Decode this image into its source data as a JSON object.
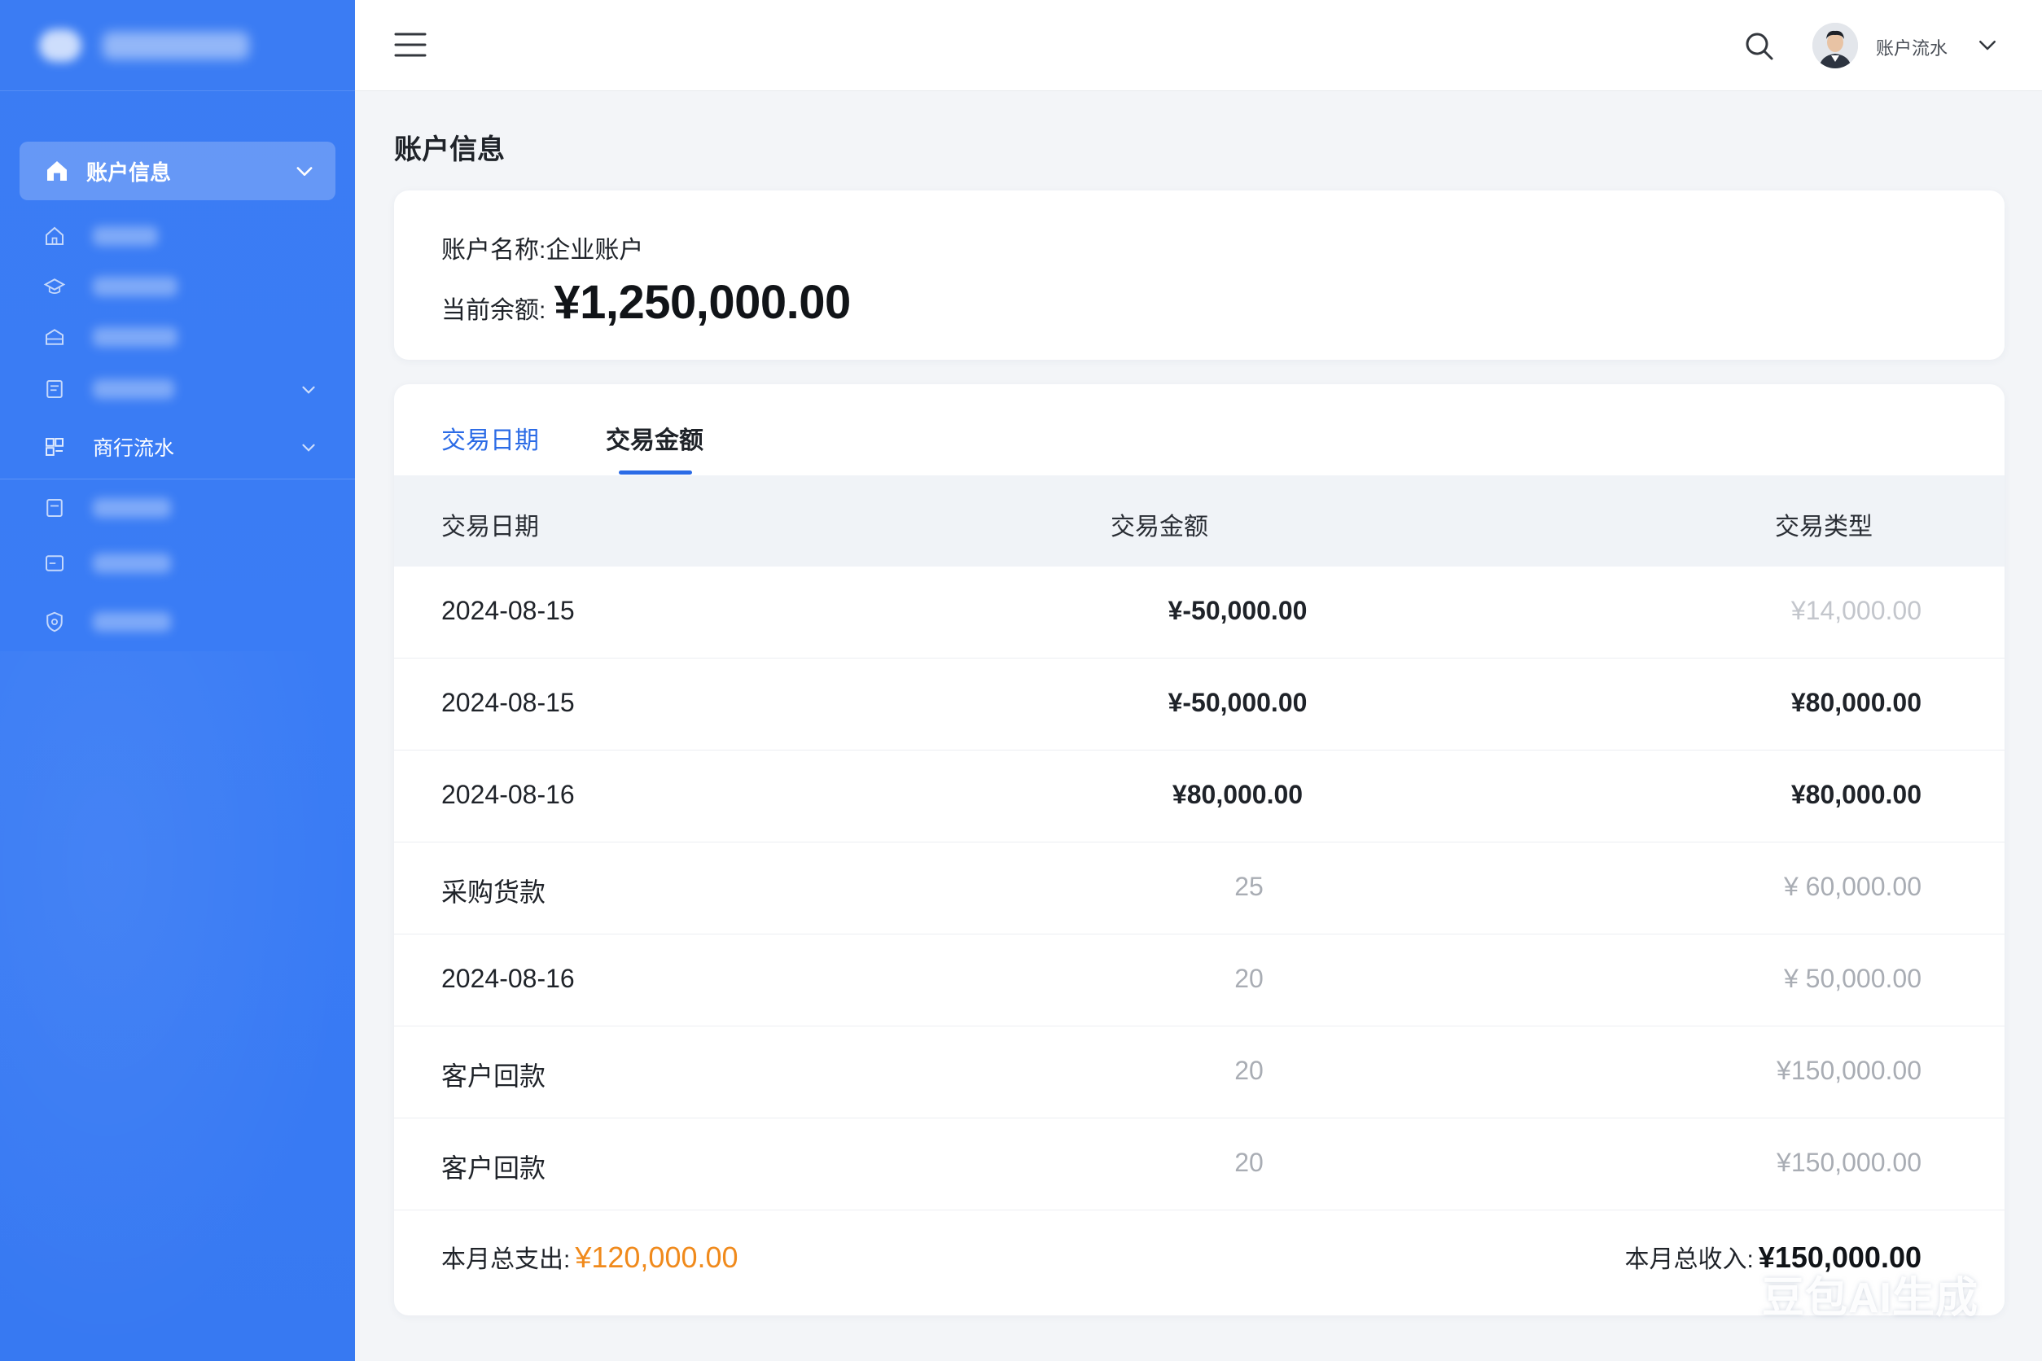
{
  "header": {
    "user_name": "账户流水"
  },
  "sidebar": {
    "active_item": {
      "label": "账户信息",
      "icon": "home-icon"
    },
    "items": [
      {
        "label": "",
        "icon": "home-outline-icon",
        "blurred": true
      },
      {
        "label": "",
        "icon": "shield-hat-icon",
        "blurred": true
      },
      {
        "label": "",
        "icon": "bank-icon",
        "blurred": true
      },
      {
        "label": "",
        "icon": "document-icon",
        "blurred": true,
        "has_submenu": true
      },
      {
        "label": "商行流水",
        "icon": "grid-icon",
        "blurred": false,
        "has_submenu": true
      },
      {
        "label": "",
        "icon": "file-icon",
        "blurred": true
      },
      {
        "label": "",
        "icon": "card-icon",
        "blurred": true
      },
      {
        "label": "",
        "icon": "shield-icon",
        "blurred": true
      }
    ]
  },
  "page": {
    "title": "账户信息"
  },
  "account": {
    "name_label": "账户名称:",
    "name_value": "企业账户",
    "balance_label": "当前余额:",
    "balance_value": "¥1,250,000.00"
  },
  "table": {
    "tabs": [
      {
        "label": "交易日期",
        "active": false
      },
      {
        "label": "交易金额",
        "active": true
      }
    ],
    "columns": [
      "交易日期",
      "交易金额",
      "交易类型"
    ],
    "rows": [
      {
        "date": "2024-08-15",
        "amount": "¥-50,000.00",
        "type": "¥14,000.00"
      },
      {
        "date": "2024-08-15",
        "amount": "¥-50,000.00",
        "type": "¥80,000.00"
      },
      {
        "date": "2024-08-16",
        "amount": "¥80,000.00",
        "type": "¥80,000.00"
      },
      {
        "date": "采购货款",
        "amount": "25",
        "type": "¥ 60,000.00"
      },
      {
        "date": "2024-08-16",
        "amount": "20",
        "type": "¥ 50,000.00"
      },
      {
        "date": "客户回款",
        "amount": "20",
        "type": "¥150,000.00"
      },
      {
        "date": "客户回款",
        "amount": "20",
        "type": "¥150,000.00"
      }
    ]
  },
  "summary": {
    "expense_label": "本月总支出:",
    "expense_value": "¥120,000.00",
    "income_label": "本月总收入:",
    "income_value": "¥150,000.00"
  },
  "watermark": "豆包AI生成",
  "colors": {
    "sidebar": "#3a7cf5",
    "accent": "#2b6be6",
    "expense": "#f08a1c",
    "text": "#1f2329"
  }
}
